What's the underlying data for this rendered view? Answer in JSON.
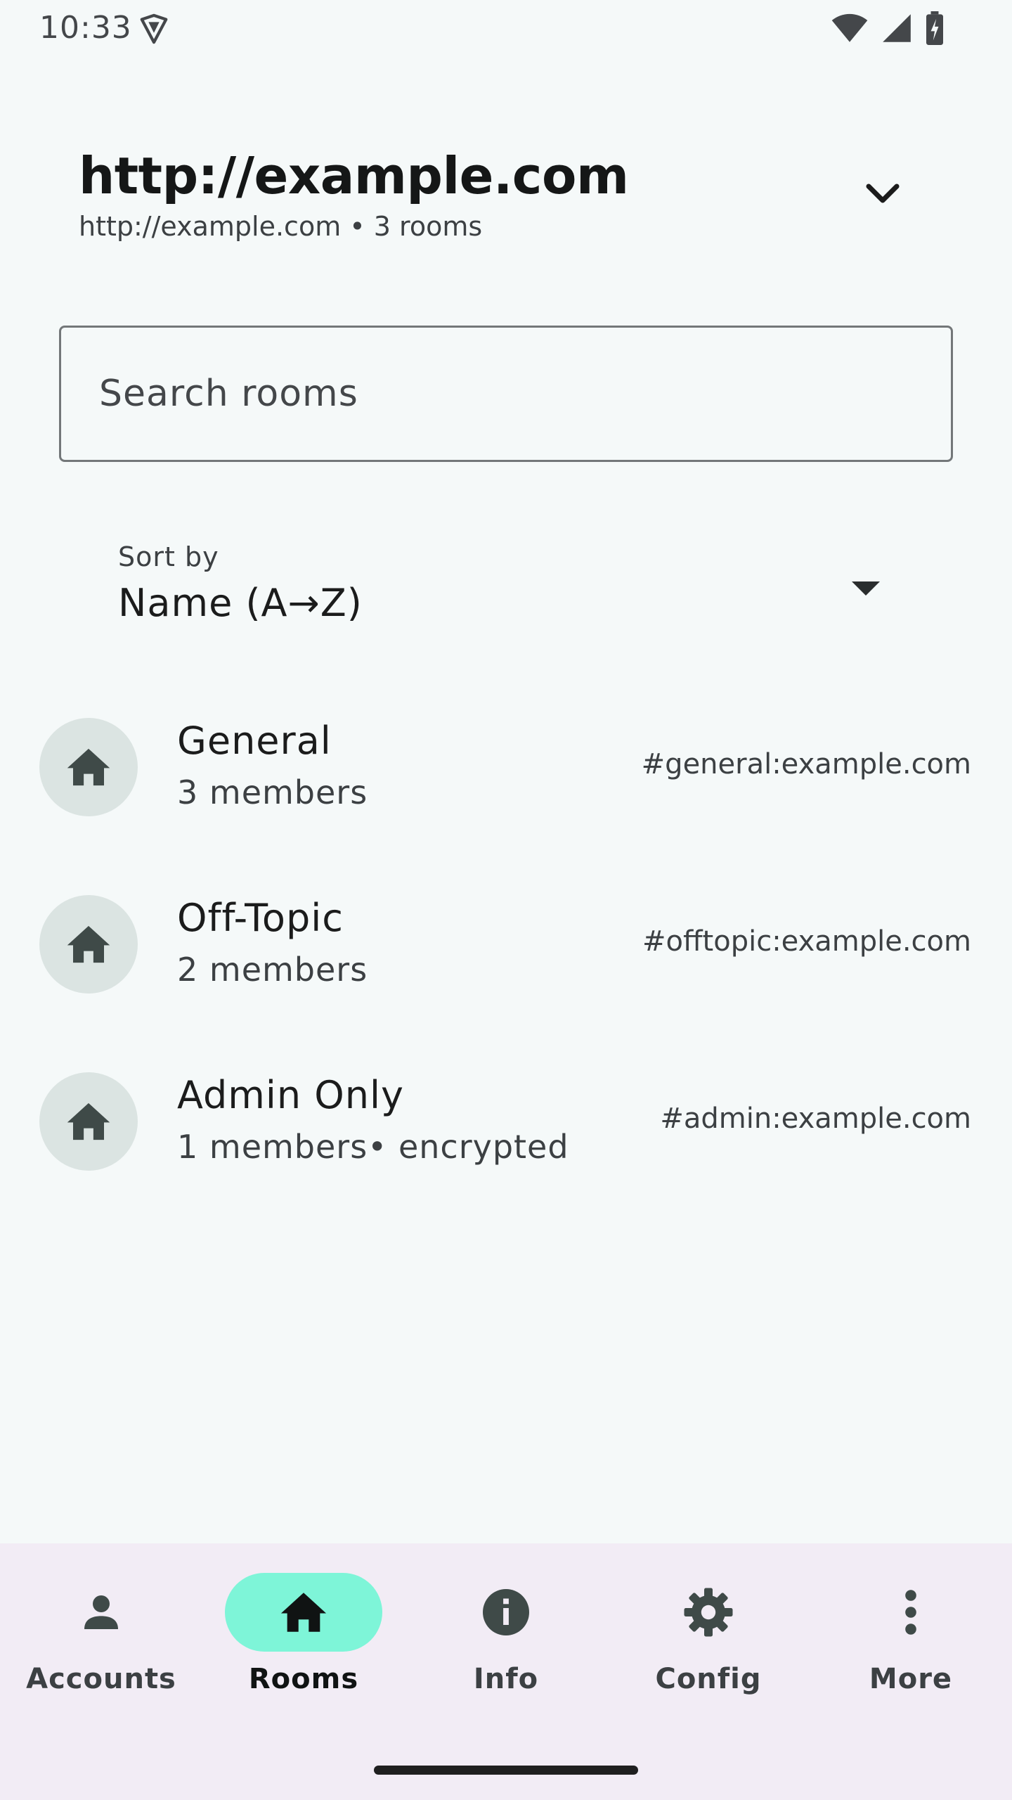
{
  "status_bar": {
    "time": "10:33",
    "icons": [
      "shield-icon",
      "wifi-icon",
      "cell-signal-icon",
      "battery-charging-icon"
    ]
  },
  "header": {
    "title": "http://example.com",
    "subtitle": "http://example.com • 3 rooms",
    "toggle_icon": "chevron-down-icon"
  },
  "search": {
    "placeholder": "Search rooms",
    "value": ""
  },
  "sort": {
    "label": "Sort by",
    "value": "Name (A→Z)",
    "icon": "dropdown-arrow-icon"
  },
  "rooms": [
    {
      "name": "General",
      "meta": "3 members",
      "alias": "#general:example.com",
      "icon": "home-icon"
    },
    {
      "name": "Off-Topic",
      "meta": "2 members",
      "alias": "#offtopic:example.com",
      "icon": "home-icon"
    },
    {
      "name": "Admin Only",
      "meta": "1 members• encrypted",
      "alias": "#admin:example.com",
      "icon": "home-icon"
    }
  ],
  "bottom_nav": {
    "active": "Rooms",
    "items": [
      {
        "label": "Accounts",
        "icon": "person-icon"
      },
      {
        "label": "Rooms",
        "icon": "home-icon"
      },
      {
        "label": "Info",
        "icon": "info-icon"
      },
      {
        "label": "Config",
        "icon": "gear-icon"
      },
      {
        "label": "More",
        "icon": "more-vert-icon"
      }
    ]
  },
  "colors": {
    "background": "#f5f9f9",
    "nav_background": "#f2ecf5",
    "active_pill": "#7ef5d8",
    "avatar_bg": "#dbe4e2",
    "icon_dark": "#3f4a48"
  }
}
